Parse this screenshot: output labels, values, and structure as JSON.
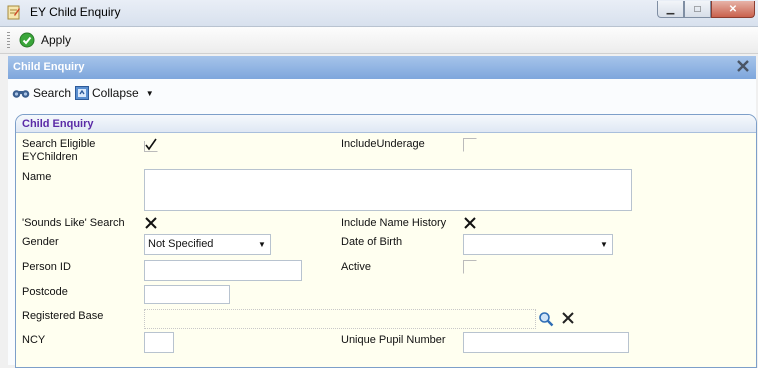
{
  "window": {
    "title": "EY Child Enquiry"
  },
  "toolbar": {
    "apply_label": "Apply"
  },
  "panel": {
    "title": "Child Enquiry",
    "search_label": "Search",
    "collapse_label": "Collapse"
  },
  "group": {
    "title": "Child Enquiry"
  },
  "fields": {
    "search_eligible_line1": "Search Eligible",
    "search_eligible_line2": "EYChildren",
    "include_underage": "IncludeUnderage",
    "name": "Name",
    "sounds_like": "'Sounds Like' Search",
    "include_name_history": "Include Name History",
    "gender": "Gender",
    "gender_value": "Not Specified",
    "date_of_birth": "Date of Birth",
    "person_id": "Person ID",
    "active": "Active",
    "postcode": "Postcode",
    "registered_base": "Registered Base",
    "ncy": "NCY",
    "upn": "Unique Pupil Number"
  },
  "colors": {
    "accent": "#7ea6dc",
    "group_title": "#5a2aa6",
    "form_bg": "#fffff0"
  }
}
